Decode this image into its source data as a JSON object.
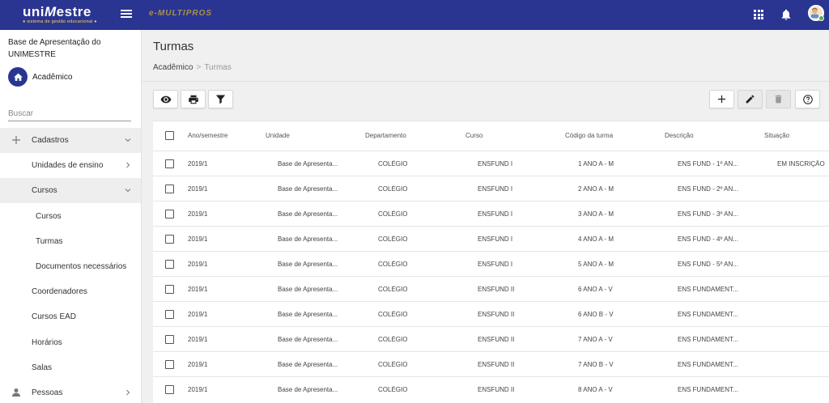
{
  "header": {
    "logo_main_a": "uni",
    "logo_main_m": "M",
    "logo_main_b": "estre",
    "logo_sub": "● sistema de gestão educacional ●",
    "secondary_brand": "e-MULTIPROS",
    "colors": {
      "topbar": "#2a3592",
      "accent": "#ffd54f",
      "online": "#4caf50"
    }
  },
  "sidebar": {
    "org_name": "Base de Apresentação do UNIMESTRE",
    "module_label": "Acadêmico",
    "search_placeholder": "Buscar",
    "items": [
      {
        "label": "Cadastros",
        "icon": "plus-icon"
      },
      {
        "label": "Unidades de ensino"
      },
      {
        "label": "Cursos"
      },
      {
        "label": "Cursos"
      },
      {
        "label": "Turmas"
      },
      {
        "label": "Documentos necessários"
      },
      {
        "label": "Coordenadores"
      },
      {
        "label": "Cursos EAD"
      },
      {
        "label": "Horários"
      },
      {
        "label": "Salas"
      },
      {
        "label": "Pessoas",
        "icon": "person-icon"
      }
    ]
  },
  "page": {
    "title": "Turmas",
    "breadcrumb_root": "Acadêmico",
    "breadcrumb_sep": ">",
    "breadcrumb_current": "Turmas"
  },
  "table": {
    "headers": [
      "Ano/semestre",
      "Unidade",
      "Departamento",
      "Curso",
      "Código da turma",
      "Descrição",
      "Situação"
    ],
    "rows": [
      [
        "2019/1",
        "Base de Apresenta...",
        "COLÉGIO",
        "ENSFUND I",
        "1 ANO A - M",
        "ENS FUND - 1º AN...",
        "EM INSCRIÇÃO"
      ],
      [
        "2019/1",
        "Base de Apresenta...",
        "COLÉGIO",
        "ENSFUND I",
        "2 ANO A - M",
        "ENS FUND - 2º AN...",
        ""
      ],
      [
        "2019/1",
        "Base de Apresenta...",
        "COLÉGIO",
        "ENSFUND I",
        "3 ANO A - M",
        "ENS FUND - 3º AN...",
        ""
      ],
      [
        "2019/1",
        "Base de Apresenta...",
        "COLÉGIO",
        "ENSFUND I",
        "4 ANO A - M",
        "ENS FUND - 4º AN...",
        ""
      ],
      [
        "2019/1",
        "Base de Apresenta...",
        "COLÉGIO",
        "ENSFUND I",
        "5 ANO A - M",
        "ENS FUND - 5º AN...",
        ""
      ],
      [
        "2019/1",
        "Base de Apresenta...",
        "COLÉGIO",
        "ENSFUND II",
        "6 ANO A - V",
        "ENS FUNDAMENT...",
        ""
      ],
      [
        "2019/1",
        "Base de Apresenta...",
        "COLÉGIO",
        "ENSFUND II",
        "6 ANO B - V",
        "ENS FUNDAMENT...",
        ""
      ],
      [
        "2019/1",
        "Base de Apresenta...",
        "COLÉGIO",
        "ENSFUND II",
        "7 ANO A - V",
        "ENS FUNDAMENT...",
        ""
      ],
      [
        "2019/1",
        "Base de Apresenta...",
        "COLÉGIO",
        "ENSFUND II",
        "7 ANO B - V",
        "ENS FUNDAMENT...",
        ""
      ],
      [
        "2019/1",
        "Base de Apresenta...",
        "COLÉGIO",
        "ENSFUND II",
        "8 ANO A - V",
        "ENS FUNDAMENT...",
        ""
      ]
    ]
  }
}
